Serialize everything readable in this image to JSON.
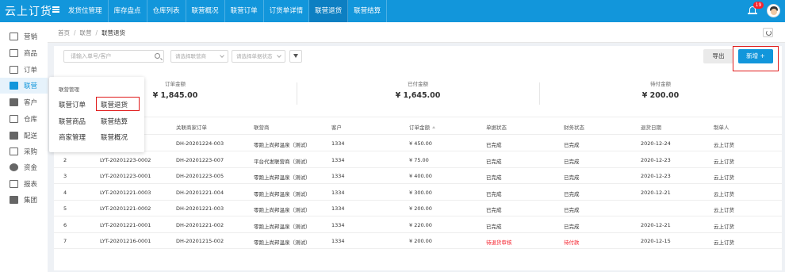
{
  "app": {
    "logo": "云上订货"
  },
  "nav": [
    {
      "label": "发货位管理",
      "active": false
    },
    {
      "label": "库存盘点",
      "active": false
    },
    {
      "label": "仓库列表",
      "active": false
    },
    {
      "label": "联营概况",
      "active": false
    },
    {
      "label": "联营订单",
      "active": false
    },
    {
      "label": "订货单详情",
      "active": false
    },
    {
      "label": "联营退货",
      "active": true
    },
    {
      "label": "联营结算",
      "active": false
    }
  ],
  "header": {
    "notification_count": "19"
  },
  "sidebar": {
    "items": [
      {
        "label": "营销",
        "icon": "marketing-icon"
      },
      {
        "label": "商品",
        "icon": "goods-icon"
      },
      {
        "label": "订单",
        "icon": "order-icon"
      },
      {
        "label": "联营",
        "icon": "users-icon",
        "active": true
      },
      {
        "label": "客户",
        "icon": "customer-icon"
      },
      {
        "label": "仓库",
        "icon": "warehouse-icon"
      },
      {
        "label": "配送",
        "icon": "truck-icon"
      },
      {
        "label": "采购",
        "icon": "cart-icon"
      },
      {
        "label": "资金",
        "icon": "money-icon"
      },
      {
        "label": "报表",
        "icon": "report-icon"
      },
      {
        "label": "集团",
        "icon": "group-icon"
      }
    ]
  },
  "breadcrumb": {
    "home": "首页",
    "parent": "联营",
    "current": "联营退货"
  },
  "filters": {
    "search_placeholder": "请输入单号/客户",
    "supplier_placeholder": "请选择联营商",
    "status_placeholder": "请选择单据状态"
  },
  "toolbar": {
    "export_label": "导出",
    "new_label": "新增 +"
  },
  "summary": [
    {
      "label": "订单金额",
      "value": "¥ 1,845.00"
    },
    {
      "label": "已付金额",
      "value": "¥ 1,645.00"
    },
    {
      "label": "待付金额",
      "value": "¥ 200.00"
    }
  ],
  "table": {
    "columns": [
      "",
      "关联商家订单",
      "联营商",
      "客户",
      "订单金额",
      "单据状态",
      "财务状态",
      "退货日期",
      "制单人"
    ],
    "rows": [
      [
        "",
        "DH-20201224-003",
        "零跑上尚邦温泉（测试）",
        "1334",
        "¥ 450.00",
        "已完成",
        "已完成",
        "2020-12-24",
        "云上订货"
      ],
      [
        "2",
        "LYT-20201223-0002",
        "DH-20201223-007",
        "平台代发联营商（测试）",
        "1334",
        "¥ 75.00",
        "已完成",
        "已完成",
        "2020-12-23",
        "云上订货"
      ],
      [
        "3",
        "LYT-20201223-0001",
        "DH-20201223-005",
        "零跑上尚邦温泉（测试）",
        "1334",
        "¥ 400.00",
        "已完成",
        "已完成",
        "2020-12-23",
        "云上订货"
      ],
      [
        "4",
        "LYT-20201221-0003",
        "DH-20201221-004",
        "零跑上尚邦温泉（测试）",
        "1334",
        "¥ 300.00",
        "已完成",
        "已完成",
        "2020-12-21",
        "云上订货"
      ],
      [
        "5",
        "LYT-20201221-0002",
        "DH-20201221-003",
        "零跑上尚邦温泉（测试）",
        "1334",
        "¥ 200.00",
        "已完成",
        "已完成",
        "",
        "云上订货"
      ],
      [
        "6",
        "LYT-20201221-0001",
        "DH-20201221-002",
        "零跑上尚邦温泉（测试）",
        "1334",
        "¥ 220.00",
        "已完成",
        "已完成",
        "2020-12-21",
        "云上订货"
      ],
      [
        "7",
        "LYT-20201216-0001",
        "DH-20201215-002",
        "零跑上尚邦温泉（测试）",
        "1334",
        "¥ 200.00",
        "待退货审核",
        "待付款",
        "2020-12-15",
        "云上订货"
      ]
    ]
  },
  "dropdown": {
    "heading": "联营管理",
    "items": [
      "联营订单",
      "联营退货",
      "联营商品",
      "联营结算",
      "商家管理",
      "联营概况"
    ]
  },
  "colors": {
    "primary": "#1296db",
    "danger": "#f5222d",
    "highlight": "#e01b1b"
  }
}
